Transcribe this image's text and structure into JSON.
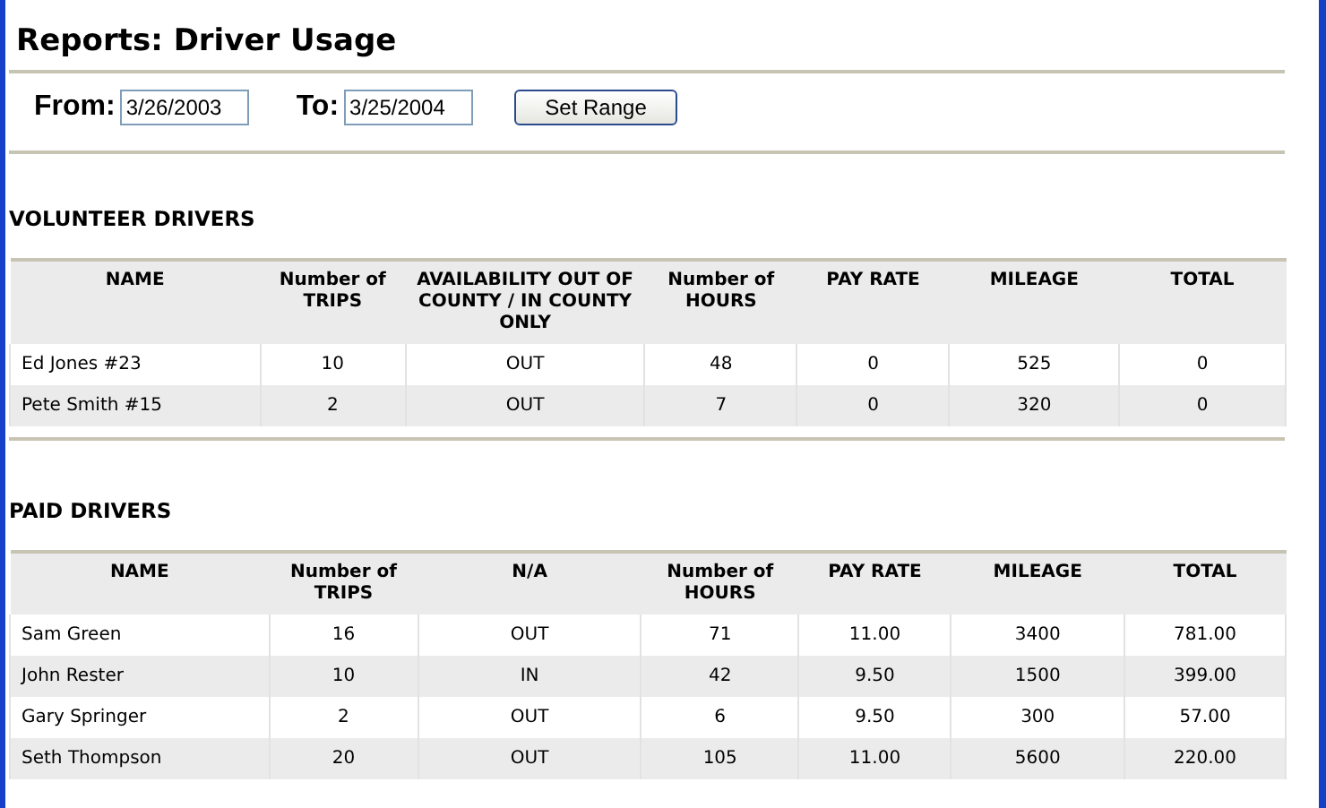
{
  "title": "Reports: Driver Usage",
  "range": {
    "from_label": "From:",
    "from_value": "3/26/2003",
    "to_label": "To:",
    "to_value": "3/25/2004",
    "button": "Set Range"
  },
  "sections": [
    {
      "title": "VOLUNTEER DRIVERS",
      "columns": [
        "NAME",
        "Number of TRIPS",
        "AVAILABILITY OUT OF COUNTY / IN COUNTY ONLY",
        "Number of HOURS",
        "PAY RATE",
        "MILEAGE",
        "TOTAL"
      ],
      "rows": [
        [
          "Ed Jones #23",
          "10",
          "OUT",
          "48",
          "0",
          "525",
          "0"
        ],
        [
          "Pete Smith #15",
          "2",
          "OUT",
          "7",
          "0",
          "320",
          "0"
        ]
      ]
    },
    {
      "title": "PAID DRIVERS",
      "columns": [
        "NAME",
        "Number of TRIPS",
        "N/A",
        "Number of HOURS",
        "PAY RATE",
        "MILEAGE",
        "TOTAL"
      ],
      "rows": [
        [
          "Sam Green",
          "16",
          "OUT",
          "71",
          "11.00",
          "3400",
          "781.00"
        ],
        [
          "John Rester",
          "10",
          "IN",
          "42",
          "9.50",
          "1500",
          "399.00"
        ],
        [
          "Gary Springer",
          "2",
          "OUT",
          "6",
          "9.50",
          "300",
          "57.00"
        ],
        [
          "Seth Thompson",
          "20",
          "OUT",
          "105",
          "11.00",
          "5600",
          "220.00"
        ]
      ]
    }
  ]
}
